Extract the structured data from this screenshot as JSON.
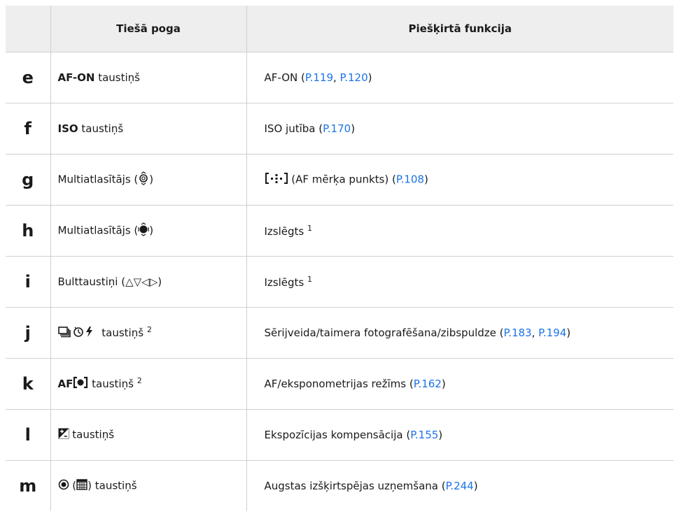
{
  "headers": {
    "col1": "",
    "col2": "Tiešā poga",
    "col3": "Piešķirtā funkcija"
  },
  "rows": [
    {
      "letter": "e",
      "btn_bold": "AF-ON",
      "btn_text": " taustiņš",
      "func_text": "AF-ON (",
      "refs": [
        "P.119",
        "P.120"
      ],
      "func_tail": ")"
    },
    {
      "letter": "f",
      "btn_bold": "ISO",
      "btn_text": " taustiņš",
      "func_text": "ISO jutība (",
      "refs": [
        "P.170"
      ],
      "func_tail": ")"
    },
    {
      "letter": "g",
      "btn_text": "Multiatlasītājs (",
      "btn_icon": "multiselector-tilt-icon",
      "btn_tail": ")",
      "func_icon": "af-target-icon",
      "func_text": " (AF mērķa punkts) (",
      "refs": [
        "P.108"
      ],
      "func_tail": ")"
    },
    {
      "letter": "h",
      "btn_text": "Multiatlasītājs (",
      "btn_icon": "multiselector-press-icon",
      "btn_tail": ")",
      "func_text": "Izslēgts",
      "func_sup": "1"
    },
    {
      "letter": "i",
      "btn_text": "Bulttaustiņi (",
      "btn_symbols": "△▽◁▷",
      "btn_tail": ")",
      "func_text": "Izslēgts",
      "func_sup": "1"
    },
    {
      "letter": "j",
      "btn_icon": "sequential-timer-flash-icon",
      "btn_text": " taustiņš",
      "btn_sup": "2",
      "func_text": "Sērijveida/taimera fotografēšana/zibspuldze (",
      "refs": [
        "P.183",
        "P.194"
      ],
      "func_tail": ")"
    },
    {
      "letter": "k",
      "btn_bold": "AF",
      "btn_icon": "metering-icon",
      "btn_text": " taustiņš",
      "btn_sup": "2",
      "func_text": "AF/eksponometrijas režīms (",
      "refs": [
        "P.162"
      ],
      "func_tail": ")"
    },
    {
      "letter": "l",
      "btn_icon": "exposure-comp-icon",
      "btn_text": " taustiņš",
      "func_text": "Ekspozīcijas kompensācija (",
      "refs": [
        "P.155"
      ],
      "func_tail": ")"
    },
    {
      "letter": "m",
      "btn_icon": "record-icon",
      "btn_text2": " (",
      "btn_icon2": "grid-icon",
      "btn_text": ") taustiņš",
      "func_text": "Augstas izšķirtspējas uzņemšana (",
      "refs": [
        "P.244"
      ],
      "func_tail": ")"
    }
  ],
  "colors": {
    "header_bg": "#eeeeee",
    "link": "#1a73e8",
    "border": "#d0d0d0"
  }
}
